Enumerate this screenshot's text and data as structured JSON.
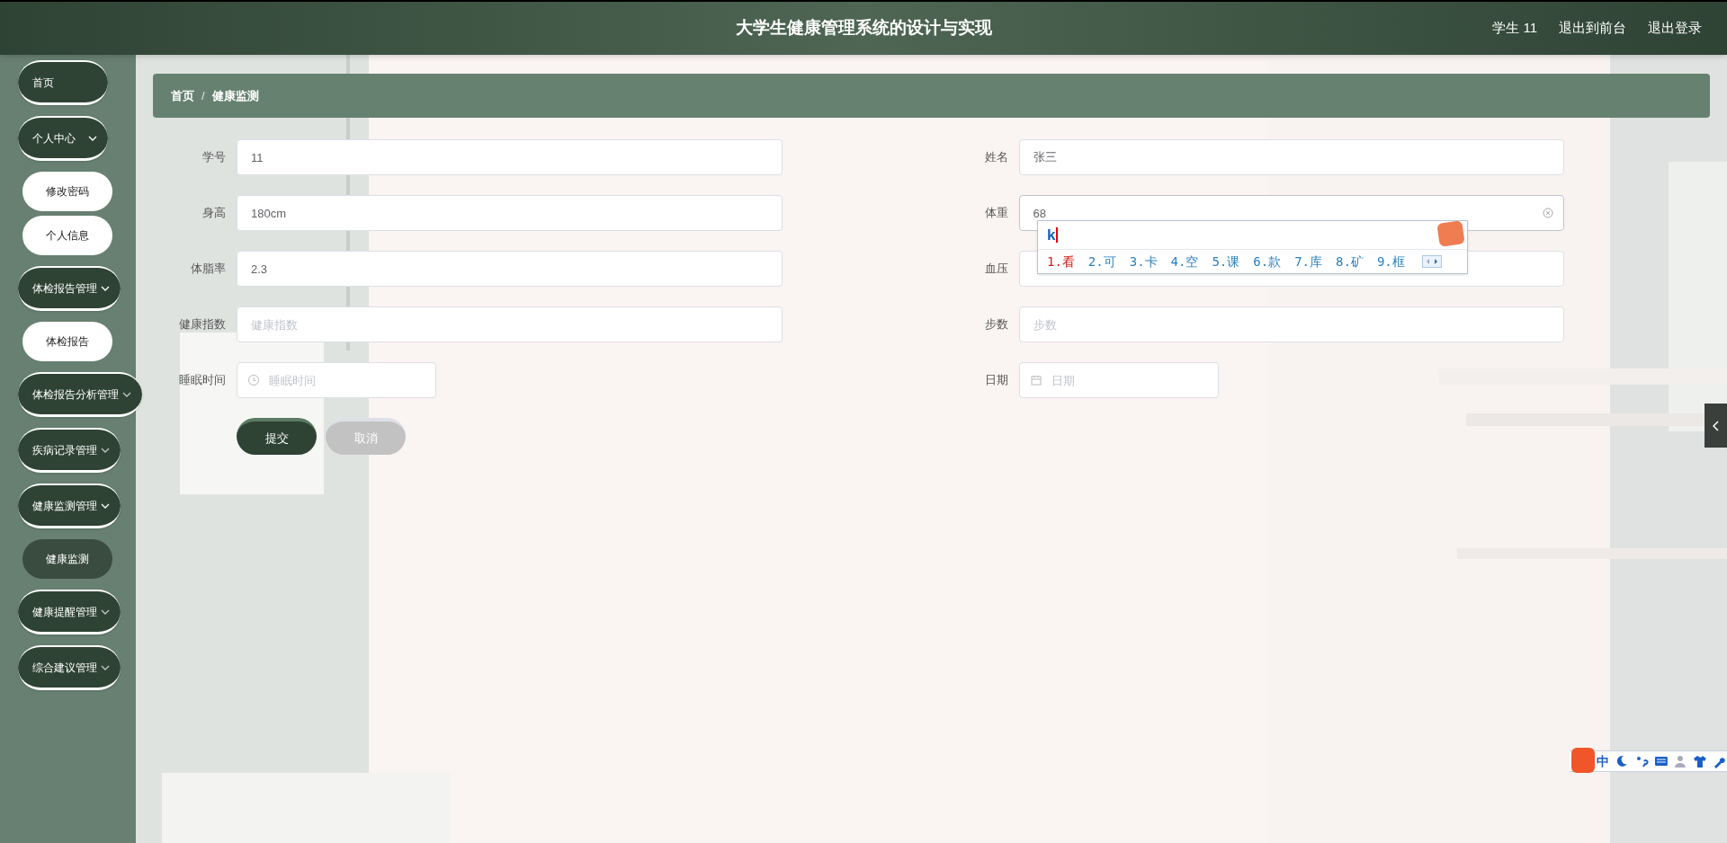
{
  "header": {
    "title": "大学生健康管理系统的设计与实现",
    "links": [
      "学生 11",
      "退出到前台",
      "退出登录"
    ]
  },
  "sidebar": {
    "items": [
      {
        "kind": "link",
        "label": "首页"
      },
      {
        "kind": "group",
        "label": "个人中心",
        "expanded": true,
        "children": [
          {
            "label": "修改密码",
            "selected": false
          },
          {
            "label": "个人信息",
            "selected": false
          }
        ]
      },
      {
        "kind": "group",
        "label": "体检报告管理",
        "expanded": true,
        "children": [
          {
            "label": "体检报告",
            "selected": false
          }
        ]
      },
      {
        "kind": "group",
        "label": "体检报告分析管理",
        "expanded": false
      },
      {
        "kind": "group",
        "label": "疾病记录管理",
        "expanded": false
      },
      {
        "kind": "group",
        "label": "健康监测管理",
        "expanded": true,
        "children": [
          {
            "label": "健康监测",
            "selected": true
          }
        ]
      },
      {
        "kind": "group",
        "label": "健康提醒管理",
        "expanded": false
      },
      {
        "kind": "group",
        "label": "综合建议管理",
        "expanded": false
      }
    ]
  },
  "breadcrumb": {
    "items": [
      "首页",
      "健康监测"
    ],
    "separator": "/"
  },
  "form": {
    "fields": [
      {
        "kind": "text",
        "label": "学号",
        "value": "11",
        "focused": false
      },
      {
        "kind": "text",
        "label": "姓名",
        "value": "张三",
        "focused": false
      },
      {
        "kind": "text",
        "label": "身高",
        "value": "180cm",
        "focused": false
      },
      {
        "kind": "text",
        "label": "体重",
        "value": "68",
        "focused": true
      },
      {
        "kind": "text",
        "label": "体脂率",
        "value": "2.3",
        "focused": false
      },
      {
        "kind": "text",
        "label": "血压",
        "focused": false
      },
      {
        "kind": "text",
        "label": "健康指数",
        "placeholder": "健康指数",
        "focused": false
      },
      {
        "kind": "text",
        "label": "步数",
        "placeholder": "步数",
        "focused": false
      },
      {
        "kind": "time",
        "label": "睡眠时间",
        "placeholder": "睡眠时间",
        "focused": false
      },
      {
        "kind": "date",
        "label": "日期",
        "placeholder": "日期",
        "focused": false
      }
    ],
    "buttons": [
      {
        "kind": "primary",
        "label": "提交"
      },
      {
        "kind": "secondary",
        "label": "取消"
      }
    ]
  },
  "ime_popup": {
    "composition": "k",
    "candidates": [
      {
        "label": "1.看",
        "selected": true
      },
      {
        "label": "2.可",
        "selected": false
      },
      {
        "label": "3.卡",
        "selected": false
      },
      {
        "label": "4.空",
        "selected": false
      },
      {
        "label": "5.课",
        "selected": false
      },
      {
        "label": "6.款",
        "selected": false
      },
      {
        "label": "7.库",
        "selected": false
      },
      {
        "label": "8.矿",
        "selected": false
      },
      {
        "label": "9.框",
        "selected": false
      }
    ]
  },
  "ime_toolbar": {
    "mode": "中"
  }
}
